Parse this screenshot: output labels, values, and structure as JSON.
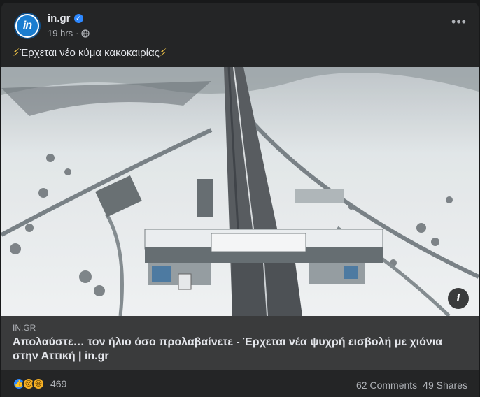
{
  "post": {
    "page_name": "in.gr",
    "avatar_text": "in",
    "time": "19 hrs",
    "separator": "·",
    "text": "Έρχεται νέο κύμα κακοκαιρίας",
    "emoji_left": "⚡",
    "emoji_right": "⚡"
  },
  "link": {
    "domain": "IN.GR",
    "title": "Απολαύστε… τον ήλιο όσο προλαβαίνετε - Έρχεται νέα ψυχρή εισβολή με χιόνια στην Αττική | in.gr"
  },
  "footer": {
    "reaction_count": "469",
    "comments": "62 Comments",
    "shares": "49 Shares"
  },
  "colors": {
    "card_bg": "#242526",
    "link_bg": "#3a3b3c",
    "accent": "#2d88ff",
    "brand": "#1a7dd0"
  },
  "icons": [
    "verified-icon",
    "globe-icon",
    "more-options-icon",
    "info-icon",
    "like-reaction-icon",
    "wow-reaction-icon",
    "haha-reaction-icon"
  ]
}
